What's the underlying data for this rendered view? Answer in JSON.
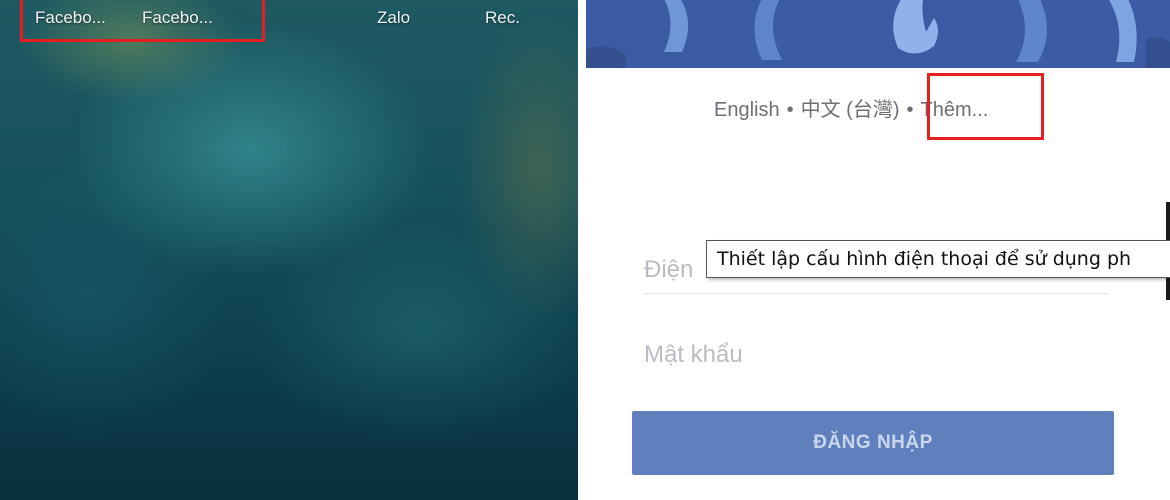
{
  "home_screen": {
    "apps": [
      {
        "label": "Facebo..."
      },
      {
        "label": "Facebo..."
      },
      {
        "label": "Zalo"
      },
      {
        "label": "Rec."
      }
    ],
    "highlight_color": "#e51f1f"
  },
  "login_screen": {
    "brand_color": "#3c5ba5",
    "languages": {
      "english": "English",
      "separator": "•",
      "chinese": "中文 (台灣)",
      "more": "Thêm..."
    },
    "phone_field": {
      "placeholder": "Điện"
    },
    "password_field": {
      "placeholder": "Mật khẩu"
    },
    "login_button": {
      "label": "ĐĂNG NHẬP",
      "color": "#5f80bd"
    },
    "tooltip": {
      "text": "Thiết lập cấu hình điện thoại để sử dụng ph"
    }
  }
}
